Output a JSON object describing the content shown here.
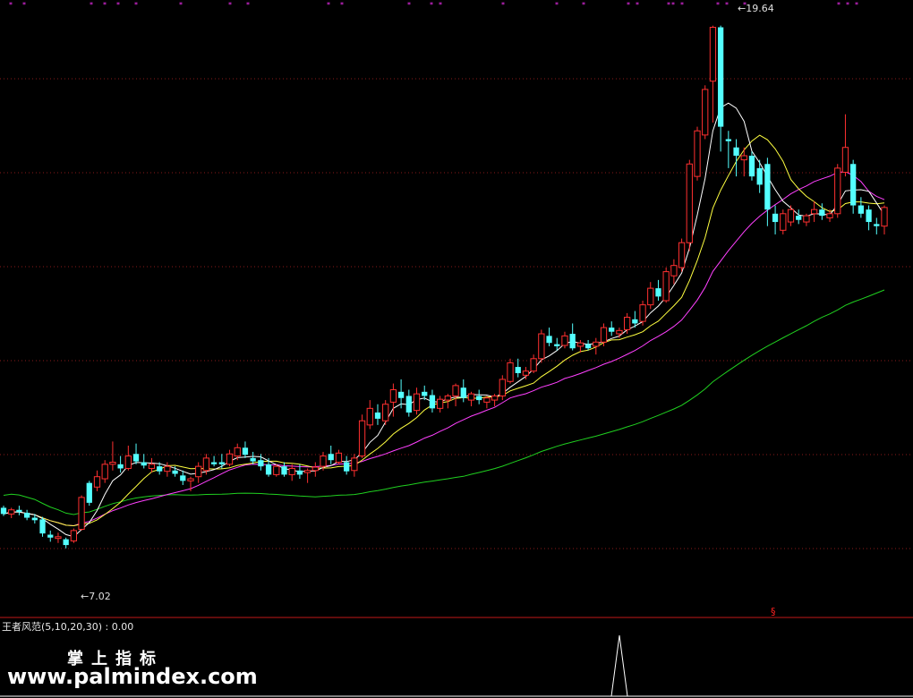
{
  "indicator": {
    "label": "王者风范(5,10,20,30) : 0.00"
  },
  "watermark": {
    "title": "掌上指标",
    "url": "www.palmindex.com"
  },
  "price_labels": {
    "high": "19.64",
    "low": "7.02"
  },
  "signal_marker": "§",
  "colors": {
    "background": "#000000",
    "up": "#ff3030",
    "down": "#54ffff",
    "ma5": "#ffffff",
    "ma10": "#ffff40",
    "ma20": "#ff40ff",
    "ma60": "#20d020",
    "grid": "#8a1a1a",
    "divider": "#c01818",
    "star": "#ff30ff",
    "indicator": "#ffffff"
  },
  "chart_data": {
    "type": "candlestick",
    "ylim": [
      6.0,
      20.0
    ],
    "high": 19.64,
    "low": 7.02,
    "candles": [
      {
        "o": 8.0,
        "h": 8.05,
        "l": 7.8,
        "c": 7.85
      },
      {
        "o": 7.85,
        "h": 8.0,
        "l": 7.75,
        "c": 7.95
      },
      {
        "o": 7.95,
        "h": 8.05,
        "l": 7.82,
        "c": 7.9
      },
      {
        "o": 7.88,
        "h": 7.95,
        "l": 7.7,
        "c": 7.76
      },
      {
        "o": 7.76,
        "h": 7.85,
        "l": 7.62,
        "c": 7.7
      },
      {
        "o": 7.72,
        "h": 7.78,
        "l": 7.3,
        "c": 7.38
      },
      {
        "o": 7.35,
        "h": 7.45,
        "l": 7.18,
        "c": 7.28
      },
      {
        "o": 7.26,
        "h": 7.4,
        "l": 7.15,
        "c": 7.3
      },
      {
        "o": 7.24,
        "h": 7.28,
        "l": 7.02,
        "c": 7.1
      },
      {
        "o": 7.2,
        "h": 7.5,
        "l": 7.15,
        "c": 7.45
      },
      {
        "o": 7.48,
        "h": 8.3,
        "l": 7.45,
        "c": 8.25
      },
      {
        "o": 8.6,
        "h": 8.65,
        "l": 8.05,
        "c": 8.12
      },
      {
        "o": 8.5,
        "h": 8.9,
        "l": 8.4,
        "c": 8.75
      },
      {
        "o": 8.7,
        "h": 9.15,
        "l": 8.6,
        "c": 9.05
      },
      {
        "o": 9.05,
        "h": 9.6,
        "l": 8.9,
        "c": 9.1
      },
      {
        "o": 9.05,
        "h": 9.25,
        "l": 8.85,
        "c": 8.95
      },
      {
        "o": 8.95,
        "h": 9.5,
        "l": 8.9,
        "c": 9.25
      },
      {
        "o": 9.3,
        "h": 9.55,
        "l": 9.05,
        "c": 9.12
      },
      {
        "o": 9.1,
        "h": 9.3,
        "l": 8.95,
        "c": 9.02
      },
      {
        "o": 8.95,
        "h": 9.2,
        "l": 8.85,
        "c": 9.05
      },
      {
        "o": 9.0,
        "h": 9.1,
        "l": 8.8,
        "c": 8.88
      },
      {
        "o": 8.88,
        "h": 9.1,
        "l": 8.75,
        "c": 9.0
      },
      {
        "o": 8.9,
        "h": 9.0,
        "l": 8.75,
        "c": 8.82
      },
      {
        "o": 8.78,
        "h": 8.9,
        "l": 8.55,
        "c": 8.65
      },
      {
        "o": 8.65,
        "h": 8.75,
        "l": 8.4,
        "c": 8.7
      },
      {
        "o": 8.75,
        "h": 9.1,
        "l": 8.6,
        "c": 9.0
      },
      {
        "o": 8.9,
        "h": 9.3,
        "l": 8.8,
        "c": 9.2
      },
      {
        "o": 9.1,
        "h": 9.25,
        "l": 9.0,
        "c": 9.05
      },
      {
        "o": 9.1,
        "h": 9.3,
        "l": 8.95,
        "c": 9.05
      },
      {
        "o": 9.05,
        "h": 9.4,
        "l": 9.0,
        "c": 9.3
      },
      {
        "o": 9.25,
        "h": 9.55,
        "l": 9.15,
        "c": 9.45
      },
      {
        "o": 9.45,
        "h": 9.6,
        "l": 9.2,
        "c": 9.28
      },
      {
        "o": 9.2,
        "h": 9.35,
        "l": 9.05,
        "c": 9.12
      },
      {
        "o": 9.15,
        "h": 9.3,
        "l": 8.9,
        "c": 9.0
      },
      {
        "o": 9.05,
        "h": 9.2,
        "l": 8.75,
        "c": 8.8
      },
      {
        "o": 8.8,
        "h": 9.05,
        "l": 8.75,
        "c": 9.0
      },
      {
        "o": 9.0,
        "h": 9.1,
        "l": 8.75,
        "c": 8.8
      },
      {
        "o": 8.8,
        "h": 9.05,
        "l": 8.65,
        "c": 8.95
      },
      {
        "o": 8.9,
        "h": 9.05,
        "l": 8.7,
        "c": 8.8
      },
      {
        "o": 8.85,
        "h": 8.95,
        "l": 8.6,
        "c": 8.9
      },
      {
        "o": 8.9,
        "h": 9.1,
        "l": 8.75,
        "c": 8.98
      },
      {
        "o": 9.0,
        "h": 9.35,
        "l": 8.9,
        "c": 9.25
      },
      {
        "o": 9.3,
        "h": 9.5,
        "l": 9.05,
        "c": 9.15
      },
      {
        "o": 9.1,
        "h": 9.4,
        "l": 9.05,
        "c": 9.32
      },
      {
        "o": 9.1,
        "h": 9.25,
        "l": 8.8,
        "c": 8.88
      },
      {
        "o": 8.9,
        "h": 9.3,
        "l": 8.75,
        "c": 9.2
      },
      {
        "o": 9.25,
        "h": 10.25,
        "l": 9.2,
        "c": 10.1
      },
      {
        "o": 10.0,
        "h": 10.6,
        "l": 9.9,
        "c": 10.4
      },
      {
        "o": 10.3,
        "h": 10.5,
        "l": 10.0,
        "c": 10.15
      },
      {
        "o": 10.1,
        "h": 10.6,
        "l": 10.0,
        "c": 10.5
      },
      {
        "o": 10.55,
        "h": 11.0,
        "l": 10.2,
        "c": 10.85
      },
      {
        "o": 10.8,
        "h": 11.1,
        "l": 10.4,
        "c": 10.65
      },
      {
        "o": 10.7,
        "h": 10.85,
        "l": 10.2,
        "c": 10.3
      },
      {
        "o": 10.35,
        "h": 10.9,
        "l": 10.25,
        "c": 10.75
      },
      {
        "o": 10.8,
        "h": 10.95,
        "l": 10.6,
        "c": 10.7
      },
      {
        "o": 10.72,
        "h": 10.85,
        "l": 10.3,
        "c": 10.4
      },
      {
        "o": 10.4,
        "h": 10.7,
        "l": 10.3,
        "c": 10.62
      },
      {
        "o": 10.6,
        "h": 10.75,
        "l": 10.4,
        "c": 10.7
      },
      {
        "o": 10.7,
        "h": 11.0,
        "l": 10.45,
        "c": 10.95
      },
      {
        "o": 10.9,
        "h": 11.1,
        "l": 10.55,
        "c": 10.65
      },
      {
        "o": 10.6,
        "h": 10.8,
        "l": 10.45,
        "c": 10.75
      },
      {
        "o": 10.7,
        "h": 10.85,
        "l": 10.5,
        "c": 10.6
      },
      {
        "o": 10.55,
        "h": 10.7,
        "l": 10.4,
        "c": 10.65
      },
      {
        "o": 10.6,
        "h": 10.75,
        "l": 10.45,
        "c": 10.7
      },
      {
        "o": 10.7,
        "h": 11.2,
        "l": 10.6,
        "c": 11.1
      },
      {
        "o": 11.05,
        "h": 11.6,
        "l": 11.0,
        "c": 11.5
      },
      {
        "o": 11.4,
        "h": 11.6,
        "l": 11.15,
        "c": 11.25
      },
      {
        "o": 11.2,
        "h": 11.4,
        "l": 11.1,
        "c": 11.3
      },
      {
        "o": 11.3,
        "h": 11.7,
        "l": 11.25,
        "c": 11.6
      },
      {
        "o": 11.6,
        "h": 12.3,
        "l": 11.5,
        "c": 12.2
      },
      {
        "o": 12.15,
        "h": 12.35,
        "l": 11.9,
        "c": 11.98
      },
      {
        "o": 11.95,
        "h": 12.1,
        "l": 11.8,
        "c": 11.9
      },
      {
        "o": 11.92,
        "h": 12.25,
        "l": 11.85,
        "c": 12.15
      },
      {
        "o": 12.2,
        "h": 12.45,
        "l": 11.8,
        "c": 11.85
      },
      {
        "o": 11.9,
        "h": 12.05,
        "l": 11.75,
        "c": 11.98
      },
      {
        "o": 11.95,
        "h": 12.05,
        "l": 11.8,
        "c": 11.85
      },
      {
        "o": 11.9,
        "h": 12.1,
        "l": 11.7,
        "c": 12.0
      },
      {
        "o": 12.0,
        "h": 12.45,
        "l": 11.9,
        "c": 12.35
      },
      {
        "o": 12.35,
        "h": 12.5,
        "l": 12.15,
        "c": 12.25
      },
      {
        "o": 12.2,
        "h": 12.35,
        "l": 12.1,
        "c": 12.28
      },
      {
        "o": 12.3,
        "h": 12.7,
        "l": 12.2,
        "c": 12.6
      },
      {
        "o": 12.55,
        "h": 12.75,
        "l": 12.35,
        "c": 12.45
      },
      {
        "o": 12.5,
        "h": 13.0,
        "l": 12.4,
        "c": 12.9
      },
      {
        "o": 12.9,
        "h": 13.45,
        "l": 12.8,
        "c": 13.3
      },
      {
        "o": 13.3,
        "h": 13.5,
        "l": 13.0,
        "c": 13.1
      },
      {
        "o": 13.0,
        "h": 13.8,
        "l": 12.95,
        "c": 13.7
      },
      {
        "o": 13.6,
        "h": 14.0,
        "l": 13.4,
        "c": 13.85
      },
      {
        "o": 13.8,
        "h": 14.5,
        "l": 13.7,
        "c": 14.4
      },
      {
        "o": 14.4,
        "h": 16.4,
        "l": 14.2,
        "c": 16.3
      },
      {
        "o": 16.0,
        "h": 17.2,
        "l": 15.9,
        "c": 17.1
      },
      {
        "o": 17.0,
        "h": 18.2,
        "l": 16.9,
        "c": 18.1
      },
      {
        "o": 18.3,
        "h": 19.64,
        "l": 17.3,
        "c": 19.6
      },
      {
        "o": 19.6,
        "h": 19.64,
        "l": 16.6,
        "c": 17.2
      },
      {
        "o": 16.9,
        "h": 17.1,
        "l": 16.2,
        "c": 16.85
      },
      {
        "o": 16.7,
        "h": 16.9,
        "l": 16.0,
        "c": 16.5
      },
      {
        "o": 16.4,
        "h": 16.7,
        "l": 16.0,
        "c": 16.5
      },
      {
        "o": 16.5,
        "h": 16.6,
        "l": 15.9,
        "c": 16.0
      },
      {
        "o": 16.2,
        "h": 16.4,
        "l": 15.6,
        "c": 15.8
      },
      {
        "o": 16.3,
        "h": 16.45,
        "l": 14.8,
        "c": 15.2
      },
      {
        "o": 15.1,
        "h": 15.3,
        "l": 14.6,
        "c": 14.9
      },
      {
        "o": 14.7,
        "h": 15.2,
        "l": 14.6,
        "c": 15.1
      },
      {
        "o": 14.9,
        "h": 15.3,
        "l": 14.8,
        "c": 15.2
      },
      {
        "o": 15.05,
        "h": 15.2,
        "l": 14.85,
        "c": 14.95
      },
      {
        "o": 14.9,
        "h": 15.1,
        "l": 14.8,
        "c": 15.05
      },
      {
        "o": 15.1,
        "h": 15.4,
        "l": 14.9,
        "c": 15.2
      },
      {
        "o": 15.2,
        "h": 15.35,
        "l": 14.95,
        "c": 15.05
      },
      {
        "o": 15.0,
        "h": 15.2,
        "l": 14.9,
        "c": 15.1
      },
      {
        "o": 15.1,
        "h": 16.3,
        "l": 15.0,
        "c": 16.2
      },
      {
        "o": 16.1,
        "h": 17.5,
        "l": 16.0,
        "c": 16.7
      },
      {
        "o": 16.3,
        "h": 16.4,
        "l": 15.1,
        "c": 15.3
      },
      {
        "o": 15.3,
        "h": 15.5,
        "l": 15.0,
        "c": 15.1
      },
      {
        "o": 15.2,
        "h": 15.3,
        "l": 14.7,
        "c": 14.9
      },
      {
        "o": 14.85,
        "h": 15.0,
        "l": 14.6,
        "c": 14.8
      },
      {
        "o": 14.8,
        "h": 15.3,
        "l": 14.6,
        "c": 15.25
      }
    ],
    "indicator_spike": 1
  }
}
